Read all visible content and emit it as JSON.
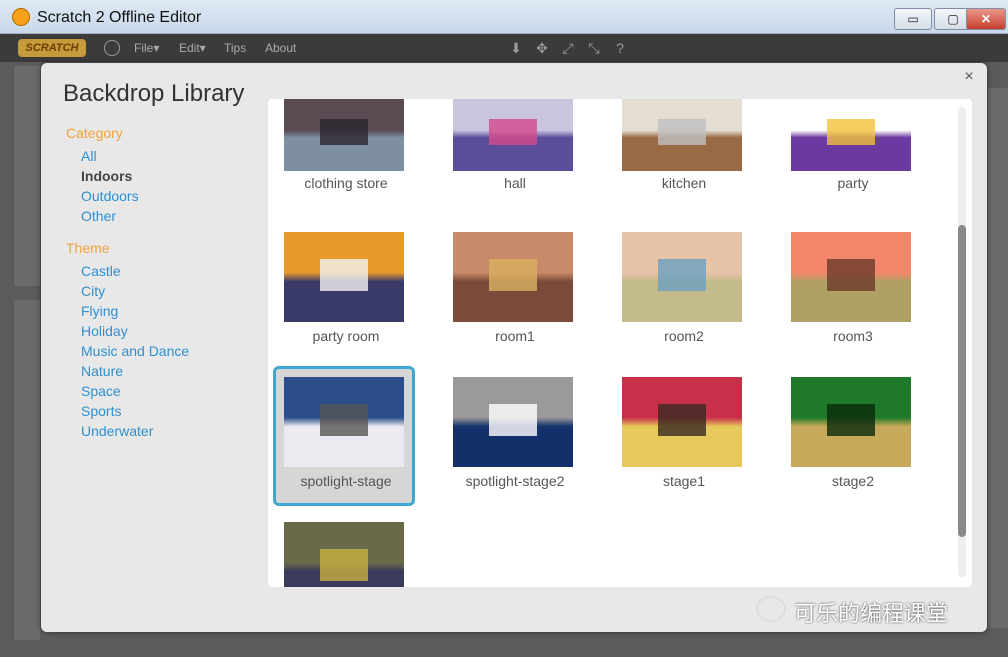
{
  "window": {
    "title": "Scratch 2 Offline Editor",
    "controls": [
      "▭",
      "▢",
      "✕"
    ]
  },
  "menubar": {
    "logo": "SCRATCH",
    "file_label": "File▾",
    "edit_label": "Edit▾",
    "tips_label": "Tips",
    "about_label": "About",
    "tools": [
      "⬇",
      "✥",
      "⤢",
      "⤡",
      "?"
    ]
  },
  "modal": {
    "title": "Backdrop Library",
    "close": "×",
    "category_heading": "Category",
    "categories": [
      "All",
      "Indoors",
      "Outdoors",
      "Other"
    ],
    "active_category": "Indoors",
    "theme_heading": "Theme",
    "themes": [
      "Castle",
      "City",
      "Flying",
      "Holiday",
      "Music and Dance",
      "Nature",
      "Space",
      "Sports",
      "Underwater"
    ]
  },
  "backdrops": [
    {
      "name": "clothing store",
      "colors": [
        "#5a4a52",
        "#7d8fa0",
        "#2b2630"
      ]
    },
    {
      "name": "hall",
      "colors": [
        "#c9c4e0",
        "#5a4e9a",
        "#d44a8c"
      ]
    },
    {
      "name": "kitchen",
      "colors": [
        "#e4ddd2",
        "#9a6a45",
        "#bfbfbf"
      ]
    },
    {
      "name": "party",
      "colors": [
        "#ffffff",
        "#6a3aa0",
        "#f2c23a"
      ]
    },
    {
      "name": "party room",
      "colors": [
        "#e79a2a",
        "#3b3b6a",
        "#f2f2f2"
      ]
    },
    {
      "name": "room1",
      "colors": [
        "#c98a6a",
        "#7a4a3a",
        "#d8b060"
      ]
    },
    {
      "name": "room2",
      "colors": [
        "#e7c3a8",
        "#c4bb8a",
        "#6aa0c0"
      ]
    },
    {
      "name": "room3",
      "colors": [
        "#f2866a",
        "#b0a064",
        "#6a3a2a"
      ]
    },
    {
      "name": "spotlight-stage",
      "colors": [
        "#2c4f8c",
        "#eaeaf0",
        "#555555"
      ]
    },
    {
      "name": "spotlight-stage2",
      "colors": [
        "#9a9a9a",
        "#14306a",
        "#ffffff"
      ]
    },
    {
      "name": "stage1",
      "colors": [
        "#c8304a",
        "#e7c85a",
        "#3a2a20"
      ]
    },
    {
      "name": "stage2",
      "colors": [
        "#1e7a2a",
        "#c8a85a",
        "#0a2a0a"
      ]
    },
    {
      "name": "",
      "colors": [
        "#6a6a4a",
        "#3a3a5a",
        "#c8b040"
      ]
    }
  ],
  "selected_backdrop": "spotlight-stage",
  "watermark": "可乐的编程课堂"
}
